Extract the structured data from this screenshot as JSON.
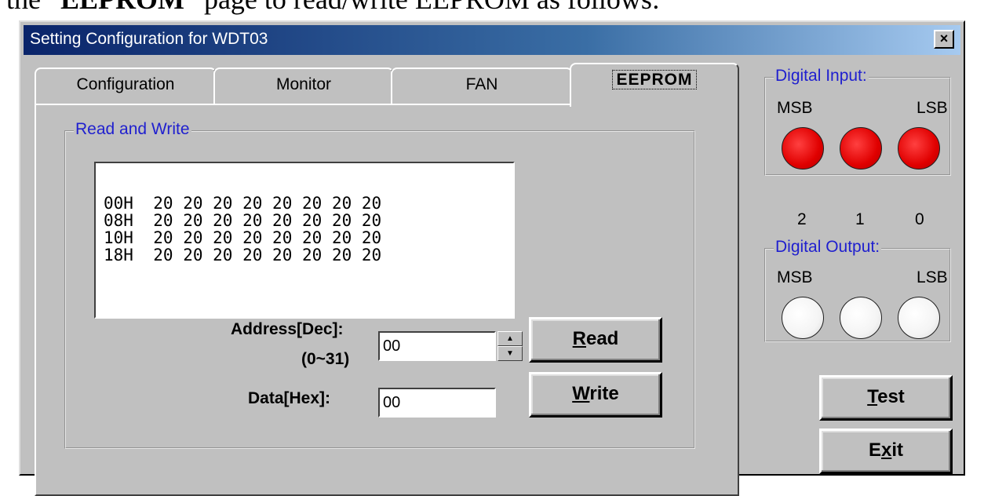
{
  "doc_text": {
    "prefix": "the “",
    "bold": "EEPROM",
    "suffix": "” page to read/write EEPROM as follows:"
  },
  "window": {
    "title": "Setting Configuration for WDT03",
    "close_label": "×"
  },
  "tabs": [
    {
      "label": "Configuration",
      "active": false
    },
    {
      "label": "Monitor",
      "active": false
    },
    {
      "label": "FAN",
      "active": false
    },
    {
      "label": "EEPROM",
      "active": true
    }
  ],
  "read_write": {
    "group_title": "Read and Write",
    "dump": [
      {
        "address": "00H",
        "bytes": [
          "20",
          "20",
          "20",
          "20",
          "20",
          "20",
          "20",
          "20"
        ]
      },
      {
        "address": "08H",
        "bytes": [
          "20",
          "20",
          "20",
          "20",
          "20",
          "20",
          "20",
          "20"
        ]
      },
      {
        "address": "10H",
        "bytes": [
          "20",
          "20",
          "20",
          "20",
          "20",
          "20",
          "20",
          "20"
        ]
      },
      {
        "address": "18H",
        "bytes": [
          "20",
          "20",
          "20",
          "20",
          "20",
          "20",
          "20",
          "20"
        ]
      }
    ],
    "address_label": "Address[Dec]:",
    "address_range": "(0~31)",
    "address_value": "00",
    "data_label": "Data[Hex]:",
    "data_value": "00",
    "read_button": {
      "hotkey": "R",
      "rest": "ead"
    },
    "write_button": {
      "hotkey": "W",
      "rest": "rite"
    }
  },
  "digital_input": {
    "title": "Digital Input:",
    "msb": "MSB",
    "lsb": "LSB",
    "states": [
      true,
      true,
      true
    ]
  },
  "bit_labels": [
    "2",
    "1",
    "0"
  ],
  "digital_output": {
    "title": "Digital Output:",
    "msb": "MSB",
    "lsb": "LSB",
    "states": [
      false,
      false,
      false
    ]
  },
  "test_button": {
    "hotkey": "T",
    "rest": "est"
  },
  "exit_button": {
    "prefix": "E",
    "hotkey": "x",
    "rest": "it"
  },
  "colors": {
    "led_on": "#e00000",
    "led_off": "#ffffff",
    "group_title": "#1f1fcf",
    "titlebar": "#0a246a"
  }
}
